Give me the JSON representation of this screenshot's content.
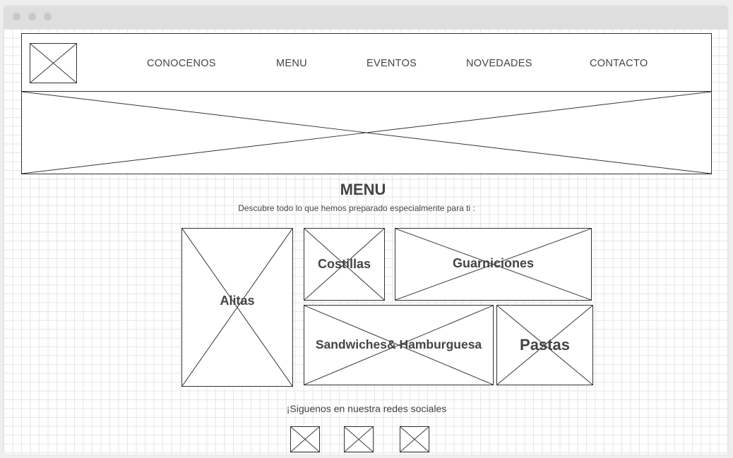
{
  "window": {
    "controls": [
      "close",
      "minimize",
      "maximize"
    ]
  },
  "header": {
    "logo": "logo-placeholder-icon",
    "nav": [
      {
        "label": "CONOCENOS"
      },
      {
        "label": "MENU"
      },
      {
        "label": "EVENTOS"
      },
      {
        "label": "NOVEDADES"
      },
      {
        "label": "CONTACTO"
      }
    ]
  },
  "hero": {
    "image": "hero-image-placeholder"
  },
  "menu_section": {
    "title": "MENU",
    "subtitle": "Descubre todo lo que hemos preparado especialmente para ti :",
    "categories": [
      {
        "label": "Alitas"
      },
      {
        "label": "Costillas"
      },
      {
        "label": "Guarniciones"
      },
      {
        "label": "Sandwiches& Hamburguesa"
      },
      {
        "label": "Pastas"
      }
    ]
  },
  "social": {
    "text": "¡Siguenos en nuestra redes sociales",
    "icons": [
      "social-icon-placeholder",
      "social-icon-placeholder",
      "social-icon-placeholder"
    ]
  },
  "colors": {
    "wireframe_stroke": "#333333",
    "text": "#444444",
    "grid": "#e6e6e6"
  }
}
